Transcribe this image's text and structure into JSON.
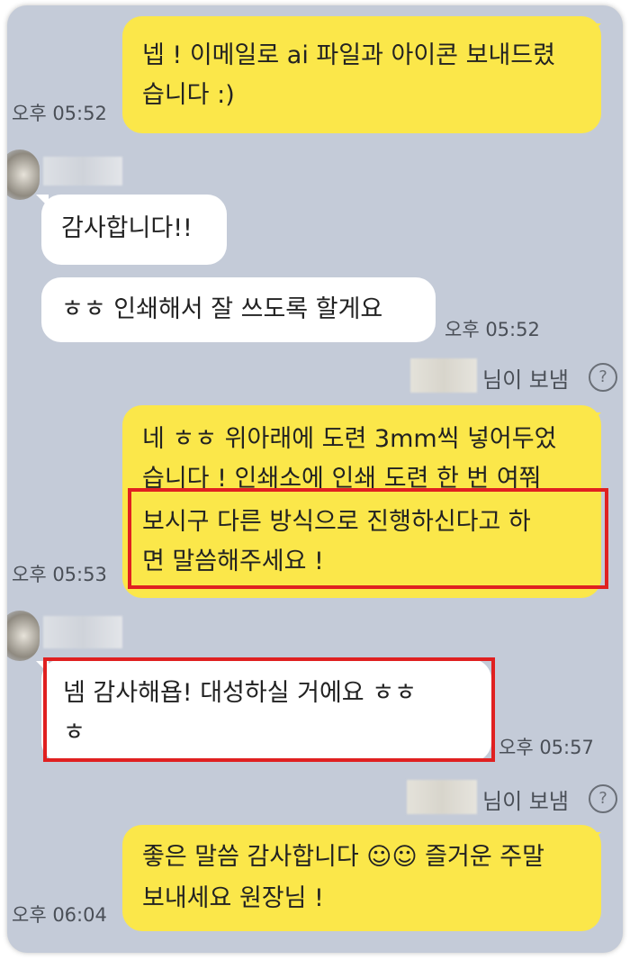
{
  "messages": [
    {
      "lines": [
        "넵 ! 이메일로 ai 파일과 아이콘 보내드렸",
        "습니다 :)"
      ],
      "time": "오후 05:52"
    },
    {
      "lines": [
        "감사합니다!!"
      ]
    },
    {
      "lines": [
        "ㅎㅎ 인쇄해서 잘 쓰도록 할게요"
      ],
      "time": "오후 05:52"
    },
    {
      "lines": [
        "네 ㅎㅎ 위아래에 도련 3mm씩 넣어두었",
        "습니다 ! 인쇄소에 인쇄 도련 한 번 여쭤",
        "보시구 다른 방식으로 진행하신다고 하",
        "면 말씀해주세요 !"
      ],
      "time": "오후 05:53"
    },
    {
      "lines": [
        "넴 감사해욥! 대성하실 거에요 ㅎㅎ",
        "ㅎ"
      ],
      "time": "오후 05:57"
    },
    {
      "lines": [
        "좋은 말씀 감사합니다 ☺☺ 즐거운 주말",
        "보내세요 원장님 !"
      ],
      "time": "오후 06:04"
    }
  ],
  "sent_label": "님이 보냄",
  "help_glyph": "?",
  "colors": {
    "background": "#c4cbd8",
    "my_bubble": "#fbe74a",
    "their_bubble": "#ffffff",
    "highlight": "#e02020"
  }
}
